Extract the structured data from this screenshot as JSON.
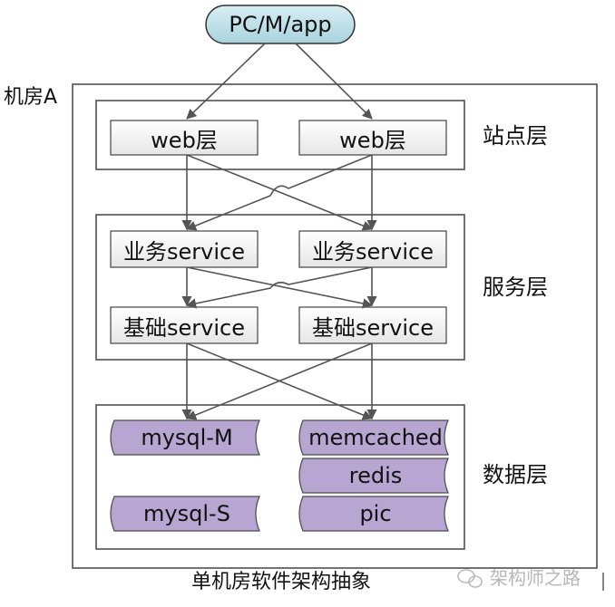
{
  "client": {
    "label": "PC/M/app"
  },
  "room": {
    "label": "机房A"
  },
  "layers": {
    "site": {
      "label": "站点层",
      "nodes": [
        "web层",
        "web层"
      ]
    },
    "service": {
      "label": "服务层",
      "business": [
        "业务service",
        "业务service"
      ],
      "base": [
        "基础service",
        "基础service"
      ]
    },
    "data": {
      "label": "数据层",
      "left": [
        "mysql-M",
        "mysql-S"
      ],
      "right": [
        "memcached",
        "redis",
        "pic"
      ]
    }
  },
  "caption": "单机房软件架构抽象",
  "watermark": "架构师之路",
  "colors": {
    "client_fill": "#bfe0e8",
    "node_fill": "#f2f2f2",
    "data_fill": "#b6a6d1",
    "line": "#555555"
  }
}
